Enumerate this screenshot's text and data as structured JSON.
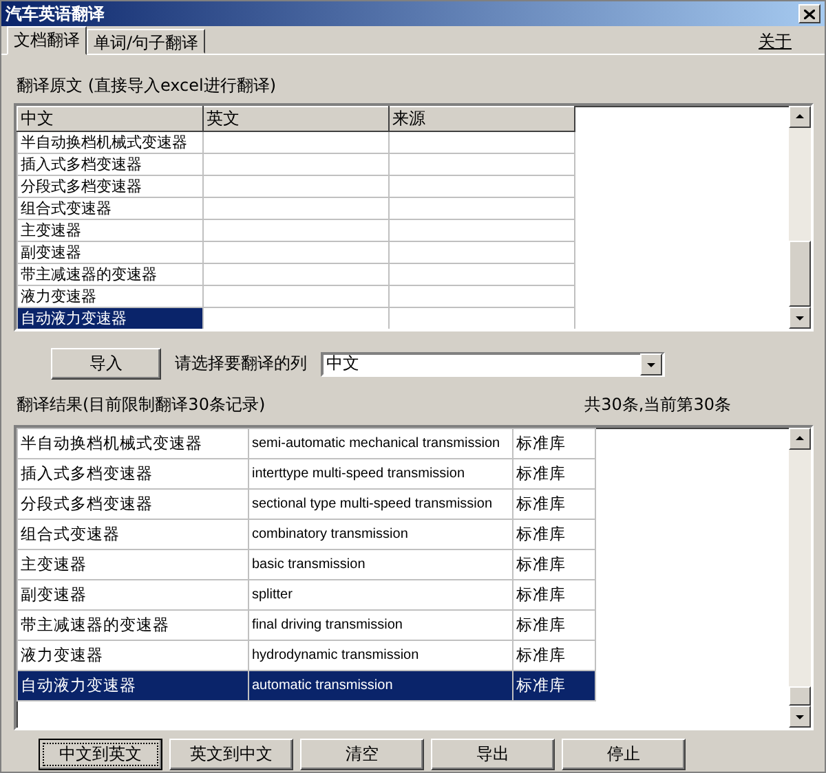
{
  "window": {
    "title": "汽车英语翻译"
  },
  "tabs": [
    {
      "label": "文档翻译",
      "selected": true
    },
    {
      "label": "单词/句子翻译",
      "selected": false
    }
  ],
  "about_link": "关于",
  "source": {
    "label": "翻译原文 (直接导入excel进行翻译)",
    "columns": [
      "中文",
      "英文",
      "来源"
    ],
    "rows": [
      {
        "chinese": "半自动换档机械式变速器",
        "selected": false
      },
      {
        "chinese": "插入式多档变速器",
        "selected": false
      },
      {
        "chinese": "分段式多档变速器",
        "selected": false
      },
      {
        "chinese": "组合式变速器",
        "selected": false
      },
      {
        "chinese": "主变速器",
        "selected": false
      },
      {
        "chinese": "副变速器",
        "selected": false
      },
      {
        "chinese": "带主减速器的变速器",
        "selected": false
      },
      {
        "chinese": "液力变速器",
        "selected": false
      },
      {
        "chinese": "自动液力变速器",
        "selected": true
      }
    ]
  },
  "import_button": "导入",
  "column_select": {
    "label": "请选择要翻译的列",
    "value": "中文"
  },
  "results": {
    "label": "翻译结果(目前限制翻译30条记录)",
    "count": "共30条,当前第30条",
    "rows": [
      {
        "chinese": "半自动换档机械式变速器",
        "english": "semi-automatic mechanical transmission",
        "source": "标准库",
        "selected": false
      },
      {
        "chinese": "插入式多档变速器",
        "english": "interttype multi-speed transmission",
        "source": "标准库",
        "selected": false
      },
      {
        "chinese": "分段式多档变速器",
        "english": "sectional type multi-speed transmission",
        "source": "标准库",
        "selected": false
      },
      {
        "chinese": "组合式变速器",
        "english": "combinatory transmission",
        "source": "标准库",
        "selected": false
      },
      {
        "chinese": "主变速器",
        "english": "basic transmission",
        "source": "标准库",
        "selected": false
      },
      {
        "chinese": "副变速器",
        "english": "splitter",
        "source": "标准库",
        "selected": false
      },
      {
        "chinese": "带主减速器的变速器",
        "english": "final driving transmission",
        "source": "标准库",
        "selected": false
      },
      {
        "chinese": "液力变速器",
        "english": "hydrodynamic transmission",
        "source": "标准库",
        "selected": false
      },
      {
        "chinese": "自动液力变速器",
        "english": "automatic transmission",
        "source": "标准库",
        "selected": true
      }
    ]
  },
  "buttons": [
    {
      "label": "中文到英文",
      "focused": true
    },
    {
      "label": "英文到中文",
      "focused": false
    },
    {
      "label": "清空",
      "focused": false
    },
    {
      "label": "导出",
      "focused": false
    },
    {
      "label": "停止",
      "focused": false
    }
  ]
}
